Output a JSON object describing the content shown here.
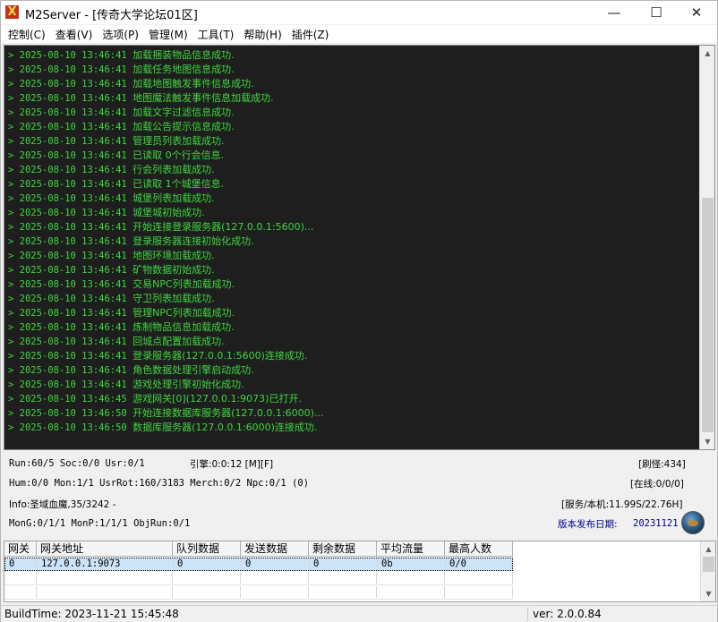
{
  "window": {
    "title": "M2Server - [传奇大学论坛01区]"
  },
  "title_buttons": {
    "minimize": "—",
    "maximize": "☐",
    "close": "✕"
  },
  "menu": [
    "控制(C)",
    "查看(V)",
    "选项(P)",
    "管理(M)",
    "工具(T)",
    "帮助(H)",
    "插件(Z)"
  ],
  "log_lines": [
    {
      "time": "> 2025-08-10 13:46:41",
      "msg": "加载捆装物品信息成功."
    },
    {
      "time": "> 2025-08-10 13:46:41",
      "msg": "加载任务地图信息成功."
    },
    {
      "time": "> 2025-08-10 13:46:41",
      "msg": "加载地图触发事件信息成功."
    },
    {
      "time": "> 2025-08-10 13:46:41",
      "msg": "地图魔法触发事件信息加载成功."
    },
    {
      "time": "> 2025-08-10 13:46:41",
      "msg": "加载文字过滤信息成功."
    },
    {
      "time": "> 2025-08-10 13:46:41",
      "msg": "加载公告提示信息成功."
    },
    {
      "time": "> 2025-08-10 13:46:41",
      "msg": "管理员列表加载成功."
    },
    {
      "time": "> 2025-08-10 13:46:41",
      "msg": "已读取 0个行会信息."
    },
    {
      "time": "> 2025-08-10 13:46:41",
      "msg": "行会列表加载成功."
    },
    {
      "time": "> 2025-08-10 13:46:41",
      "msg": "已读取 1个城堡信息."
    },
    {
      "time": "> 2025-08-10 13:46:41",
      "msg": "城堡列表加载成功."
    },
    {
      "time": "> 2025-08-10 13:46:41",
      "msg": "城堡城初始成功."
    },
    {
      "time": "> 2025-08-10 13:46:41",
      "msg": "开始连接登录服务器(127.0.0.1:5600)..."
    },
    {
      "time": "> 2025-08-10 13:46:41",
      "msg": "登录服务器连接初始化成功."
    },
    {
      "time": "> 2025-08-10 13:46:41",
      "msg": "地图环境加载成功."
    },
    {
      "time": "> 2025-08-10 13:46:41",
      "msg": "矿物数据初始成功."
    },
    {
      "time": "> 2025-08-10 13:46:41",
      "msg": "交易NPC列表加载成功."
    },
    {
      "time": "> 2025-08-10 13:46:41",
      "msg": "守卫列表加载成功."
    },
    {
      "time": "> 2025-08-10 13:46:41",
      "msg": "管理NPC列表加载成功."
    },
    {
      "time": "> 2025-08-10 13:46:41",
      "msg": "炼制物品信息加载成功."
    },
    {
      "time": "> 2025-08-10 13:46:41",
      "msg": "回城点配置加载成功."
    },
    {
      "time": "> 2025-08-10 13:46:41",
      "msg": "登录服务器(127.0.0.1:5600)连接成功."
    },
    {
      "time": "> 2025-08-10 13:46:41",
      "msg": "角色数据处理引擎启动成功."
    },
    {
      "time": "> 2025-08-10 13:46:41",
      "msg": "游戏处理引擎初始化成功."
    },
    {
      "time": "> 2025-08-10 13:46:45",
      "msg": "游戏网关[0](127.0.0.1:9073)已打开."
    },
    {
      "time": "> 2025-08-10 13:46:50",
      "msg": "开始连接数据库服务器(127.0.0.1:6000)..."
    },
    {
      "time": "> 2025-08-10 13:46:50",
      "msg": "数据库服务器(127.0.0.1:6000)连接成功."
    }
  ],
  "status": {
    "run": "Run:60/5 Soc:0/0 Usr:0/1",
    "engine": "引擎:0:0:12 [M][F]",
    "refresh": "[刷怪:434]",
    "hum": "Hum:0/0 Mon:1/1 UsrRot:160/3183 Merch:0/2 Npc:0/1 (0)",
    "online": "[在线:0/0/0]",
    "info": "Info:圣域血魔,35/3242 -",
    "service": "[服务/本机:11.99S/22.76H]",
    "mong": "MonG:0/1/1 MonP:1/1/1 ObjRun:0/1",
    "release_label": "版本发布日期:",
    "release_date": "20231121"
  },
  "gateway_table": {
    "headers": [
      "网关",
      "网关地址",
      "队列数据",
      "发送数据",
      "剩余数据",
      "平均流量",
      "最高人数"
    ],
    "rows": [
      [
        "0",
        "127.0.0.1:9073",
        "0",
        "0",
        "0",
        "0b",
        "0/0"
      ]
    ]
  },
  "statusbar": {
    "build": "BuildTime: 2023-11-21 15:45:48",
    "version": "ver: 2.0.0.84"
  }
}
